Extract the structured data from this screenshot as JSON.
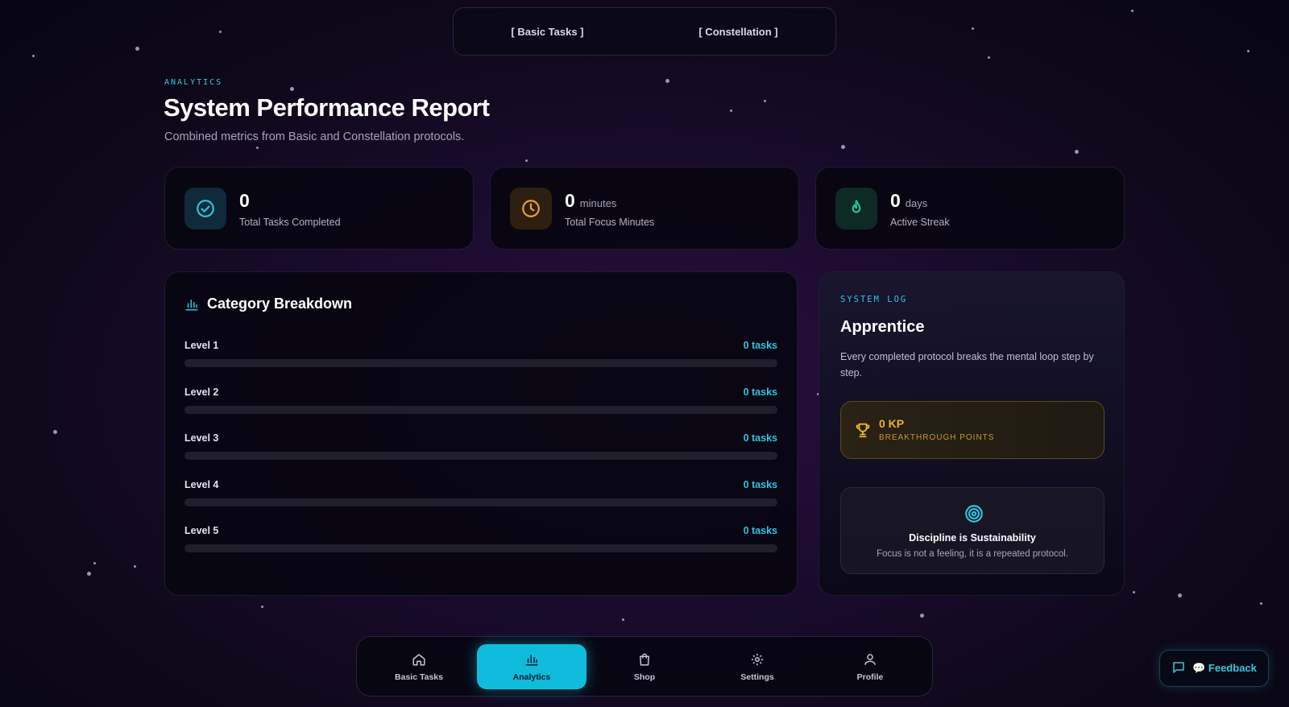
{
  "mode_switch": {
    "basic_tasks": "[ Basic Tasks ]",
    "constellation": "[ Constellation ]"
  },
  "header": {
    "eyebrow": "ANALYTICS",
    "title": "System Performance Report",
    "subtitle": "Combined metrics from Basic and Constellation protocols."
  },
  "stats": [
    {
      "icon": "check-circle-icon",
      "value": "0",
      "unit": "",
      "label": "Total Tasks Completed",
      "accent": "#2ec3df"
    },
    {
      "icon": "clock-icon",
      "value": "0",
      "unit": "minutes",
      "label": "Total Focus Minutes",
      "accent": "#f0a030"
    },
    {
      "icon": "flame-icon",
      "value": "0",
      "unit": "days",
      "label": "Active Streak",
      "accent": "#1fbf8f"
    }
  ],
  "category": {
    "title": "Category Breakdown",
    "rows": [
      {
        "name": "Level 1",
        "count": "0 tasks",
        "progress": 0
      },
      {
        "name": "Level 2",
        "count": "0 tasks",
        "progress": 0
      },
      {
        "name": "Level 3",
        "count": "0 tasks",
        "progress": 0
      },
      {
        "name": "Level 4",
        "count": "0 tasks",
        "progress": 0
      },
      {
        "name": "Level 5",
        "count": "0 tasks",
        "progress": 0
      }
    ]
  },
  "system_log": {
    "eyebrow": "SYSTEM LOG",
    "rank": "Apprentice",
    "description": "Every completed protocol breaks the mental loop step by step.",
    "kp_value": "0 KP",
    "kp_label": "BREAKTHROUGH POINTS",
    "quote_title": "Discipline is Sustainability",
    "quote_text": "Focus is not a feeling, it is a repeated protocol."
  },
  "nav": {
    "items": [
      {
        "label": "Basic Tasks",
        "icon": "home-icon",
        "active": false
      },
      {
        "label": "Analytics",
        "icon": "bar-chart-icon",
        "active": true
      },
      {
        "label": "Shop",
        "icon": "shopping-bag-icon",
        "active": false
      },
      {
        "label": "Settings",
        "icon": "gear-icon",
        "active": false
      },
      {
        "label": "Profile",
        "icon": "user-icon",
        "active": false
      }
    ]
  },
  "feedback": {
    "label": "💬 Feedback"
  },
  "colors": {
    "accent": "#0fbcdc",
    "gold": "#f0b429",
    "green": "#1fbf8f",
    "orange": "#f0a030"
  }
}
